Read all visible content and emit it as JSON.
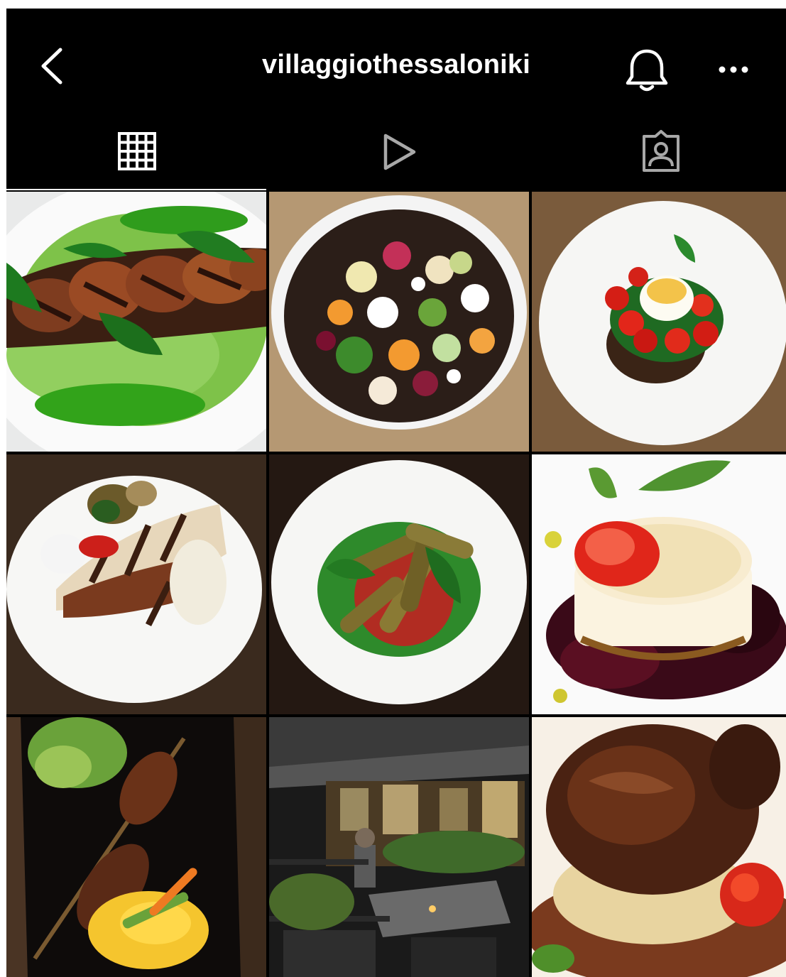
{
  "header": {
    "username": "villaggiothessaloniki",
    "back_icon": "chevron-left-icon",
    "notification_icon": "bell-icon",
    "more_icon": "ellipsis-icon"
  },
  "tabs": [
    {
      "name": "posts",
      "icon": "grid-icon",
      "active": true
    },
    {
      "name": "reels",
      "icon": "play-icon",
      "active": false
    },
    {
      "name": "tagged",
      "icon": "tagged-person-icon",
      "active": false
    }
  ],
  "posts": [
    {
      "subject": "grilled eggplant on green puree"
    },
    {
      "subject": "vegetable salad on dark crumble"
    },
    {
      "subject": "cherry tomato salad with cheese"
    },
    {
      "subject": "grilled wrap with vegetables"
    },
    {
      "subject": "breaded zucchini on tomato sauce"
    },
    {
      "subject": "goat cheese with berry sauce"
    },
    {
      "subject": "meat skewer with mashed potato"
    },
    {
      "subject": "restaurant outdoor terrace"
    },
    {
      "subject": "braised beef with sauce"
    }
  ],
  "colors": {
    "background": "#000000",
    "text": "#ffffff",
    "icon_active": "#ffffff",
    "icon_inactive": "#a8a8a8"
  }
}
